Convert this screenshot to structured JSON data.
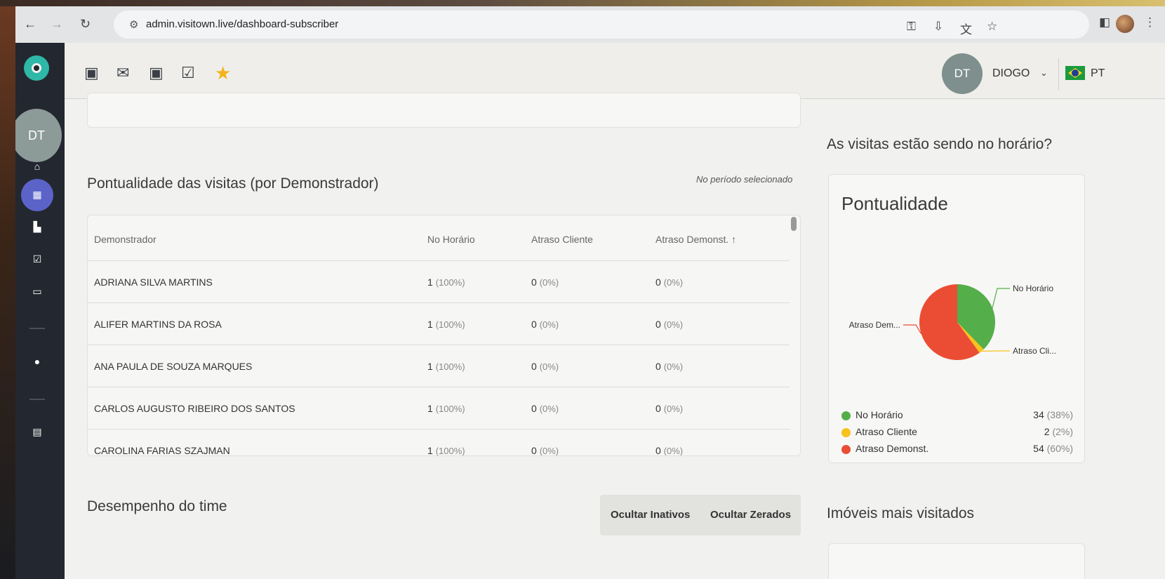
{
  "browser": {
    "url": "admin.visitown.live/dashboard-subscriber"
  },
  "header": {
    "avatar_initials": "DT",
    "user_name": "DIOGO",
    "language": "PT"
  },
  "sidebar": {
    "avatar_initials": "DT"
  },
  "punctuality_table": {
    "title": "Pontualidade das visitas (por Demonstrador)",
    "period_note": "No período selecionado",
    "columns": [
      "Demonstrador",
      "No Horário",
      "Atraso Cliente",
      "Atraso Demonst. ↑"
    ],
    "rows": [
      {
        "name": "ADRIANA SILVA MARTINS",
        "on_time": "1",
        "on_time_pct": "(100%)",
        "client_delay": "0",
        "client_delay_pct": "(0%)",
        "demo_delay": "0",
        "demo_delay_pct": "(0%)"
      },
      {
        "name": "ALIFER MARTINS DA ROSA",
        "on_time": "1",
        "on_time_pct": "(100%)",
        "client_delay": "0",
        "client_delay_pct": "(0%)",
        "demo_delay": "0",
        "demo_delay_pct": "(0%)"
      },
      {
        "name": "ANA PAULA DE SOUZA MARQUES",
        "on_time": "1",
        "on_time_pct": "(100%)",
        "client_delay": "0",
        "client_delay_pct": "(0%)",
        "demo_delay": "0",
        "demo_delay_pct": "(0%)"
      },
      {
        "name": "CARLOS AUGUSTO RIBEIRO DOS SANTOS",
        "on_time": "1",
        "on_time_pct": "(100%)",
        "client_delay": "0",
        "client_delay_pct": "(0%)",
        "demo_delay": "0",
        "demo_delay_pct": "(0%)"
      },
      {
        "name": "CAROLINA FARIAS SZAJMAN",
        "on_time": "1",
        "on_time_pct": "(100%)",
        "client_delay": "0",
        "client_delay_pct": "(0%)",
        "demo_delay": "0",
        "demo_delay_pct": "(0%)"
      }
    ]
  },
  "team_section": {
    "title": "Desempenho do time",
    "hide_inactive_label": "Ocultar Inativos",
    "hide_zeroed_label": "Ocultar Zerados"
  },
  "punctuality_side": {
    "question": "As visitas estão sendo no horário?",
    "card_title": "Pontualidade"
  },
  "most_visited": {
    "title": "Imóveis mais visitados"
  },
  "chart_data": {
    "type": "pie",
    "title": "Pontualidade",
    "slices": [
      {
        "label": "No Horário",
        "short_label": "No Horário",
        "value": 34,
        "pct": "(38%)",
        "color": "#54ae4a"
      },
      {
        "label": "Atraso Cliente",
        "short_label": "Atraso Cli...",
        "value": 2,
        "pct": "(2%)",
        "color": "#f7c21b"
      },
      {
        "label": "Atraso Demonst.",
        "short_label": "Atraso Dem...",
        "value": 54,
        "pct": "(60%)",
        "color": "#ea4d33"
      }
    ],
    "legend_position": "bottom"
  }
}
